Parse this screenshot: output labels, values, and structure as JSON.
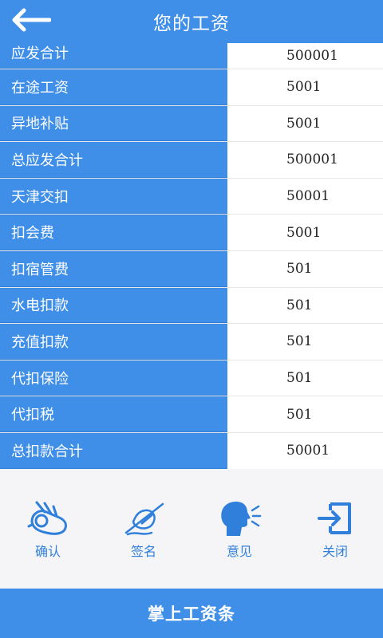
{
  "header": {
    "title": "您的工资",
    "back_icon": "arrow-left-icon"
  },
  "salary_rows": [
    {
      "label": "应发合计",
      "value": "500001"
    },
    {
      "label": "在途工资",
      "value": "5001"
    },
    {
      "label": "异地补贴",
      "value": "5001"
    },
    {
      "label": "总应发合计",
      "value": "500001"
    },
    {
      "label": "天津交扣",
      "value": "50001"
    },
    {
      "label": "扣会费",
      "value": "5001"
    },
    {
      "label": "扣宿管费",
      "value": "501"
    },
    {
      "label": "水电扣款",
      "value": "501"
    },
    {
      "label": "充值扣款",
      "value": "501"
    },
    {
      "label": "代扣保险",
      "value": "501"
    },
    {
      "label": "代扣税",
      "value": "501"
    },
    {
      "label": "总扣款合计",
      "value": "50001"
    }
  ],
  "actions": [
    {
      "label": "确认",
      "icon": "ok-hand-icon"
    },
    {
      "label": "签名",
      "icon": "signature-pen-icon"
    },
    {
      "label": "意见",
      "icon": "speaking-head-icon"
    },
    {
      "label": "关闭",
      "icon": "exit-door-icon"
    }
  ],
  "footer": {
    "title": "掌上工资条"
  },
  "colors": {
    "primary": "#3f8ee8",
    "label_text": "#ffffff",
    "value_text": "#222222",
    "action_text": "#2f7fdb",
    "icon_dark": "#1f5fa7",
    "icon_light": "#3d8ee8"
  }
}
